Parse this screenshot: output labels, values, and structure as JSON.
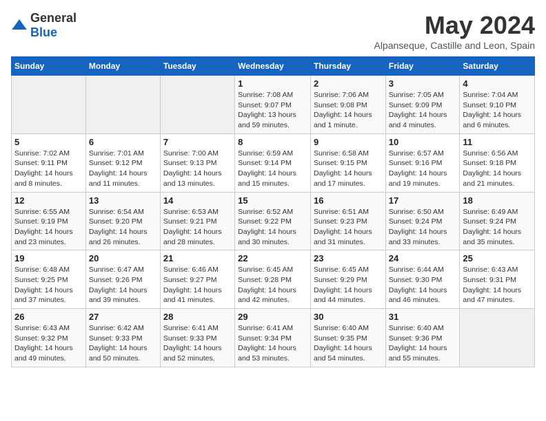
{
  "header": {
    "logo_general": "General",
    "logo_blue": "Blue",
    "month_title": "May 2024",
    "location": "Alpanseque, Castille and Leon, Spain"
  },
  "calendar": {
    "days_of_week": [
      "Sunday",
      "Monday",
      "Tuesday",
      "Wednesday",
      "Thursday",
      "Friday",
      "Saturday"
    ],
    "weeks": [
      [
        {
          "day": "",
          "info": ""
        },
        {
          "day": "",
          "info": ""
        },
        {
          "day": "",
          "info": ""
        },
        {
          "day": "1",
          "info": "Sunrise: 7:08 AM\nSunset: 9:07 PM\nDaylight: 13 hours and 59 minutes."
        },
        {
          "day": "2",
          "info": "Sunrise: 7:06 AM\nSunset: 9:08 PM\nDaylight: 14 hours and 1 minute."
        },
        {
          "day": "3",
          "info": "Sunrise: 7:05 AM\nSunset: 9:09 PM\nDaylight: 14 hours and 4 minutes."
        },
        {
          "day": "4",
          "info": "Sunrise: 7:04 AM\nSunset: 9:10 PM\nDaylight: 14 hours and 6 minutes."
        }
      ],
      [
        {
          "day": "5",
          "info": "Sunrise: 7:02 AM\nSunset: 9:11 PM\nDaylight: 14 hours and 8 minutes."
        },
        {
          "day": "6",
          "info": "Sunrise: 7:01 AM\nSunset: 9:12 PM\nDaylight: 14 hours and 11 minutes."
        },
        {
          "day": "7",
          "info": "Sunrise: 7:00 AM\nSunset: 9:13 PM\nDaylight: 14 hours and 13 minutes."
        },
        {
          "day": "8",
          "info": "Sunrise: 6:59 AM\nSunset: 9:14 PM\nDaylight: 14 hours and 15 minutes."
        },
        {
          "day": "9",
          "info": "Sunrise: 6:58 AM\nSunset: 9:15 PM\nDaylight: 14 hours and 17 minutes."
        },
        {
          "day": "10",
          "info": "Sunrise: 6:57 AM\nSunset: 9:16 PM\nDaylight: 14 hours and 19 minutes."
        },
        {
          "day": "11",
          "info": "Sunrise: 6:56 AM\nSunset: 9:18 PM\nDaylight: 14 hours and 21 minutes."
        }
      ],
      [
        {
          "day": "12",
          "info": "Sunrise: 6:55 AM\nSunset: 9:19 PM\nDaylight: 14 hours and 23 minutes."
        },
        {
          "day": "13",
          "info": "Sunrise: 6:54 AM\nSunset: 9:20 PM\nDaylight: 14 hours and 26 minutes."
        },
        {
          "day": "14",
          "info": "Sunrise: 6:53 AM\nSunset: 9:21 PM\nDaylight: 14 hours and 28 minutes."
        },
        {
          "day": "15",
          "info": "Sunrise: 6:52 AM\nSunset: 9:22 PM\nDaylight: 14 hours and 30 minutes."
        },
        {
          "day": "16",
          "info": "Sunrise: 6:51 AM\nSunset: 9:23 PM\nDaylight: 14 hours and 31 minutes."
        },
        {
          "day": "17",
          "info": "Sunrise: 6:50 AM\nSunset: 9:24 PM\nDaylight: 14 hours and 33 minutes."
        },
        {
          "day": "18",
          "info": "Sunrise: 6:49 AM\nSunset: 9:24 PM\nDaylight: 14 hours and 35 minutes."
        }
      ],
      [
        {
          "day": "19",
          "info": "Sunrise: 6:48 AM\nSunset: 9:25 PM\nDaylight: 14 hours and 37 minutes."
        },
        {
          "day": "20",
          "info": "Sunrise: 6:47 AM\nSunset: 9:26 PM\nDaylight: 14 hours and 39 minutes."
        },
        {
          "day": "21",
          "info": "Sunrise: 6:46 AM\nSunset: 9:27 PM\nDaylight: 14 hours and 41 minutes."
        },
        {
          "day": "22",
          "info": "Sunrise: 6:45 AM\nSunset: 9:28 PM\nDaylight: 14 hours and 42 minutes."
        },
        {
          "day": "23",
          "info": "Sunrise: 6:45 AM\nSunset: 9:29 PM\nDaylight: 14 hours and 44 minutes."
        },
        {
          "day": "24",
          "info": "Sunrise: 6:44 AM\nSunset: 9:30 PM\nDaylight: 14 hours and 46 minutes."
        },
        {
          "day": "25",
          "info": "Sunrise: 6:43 AM\nSunset: 9:31 PM\nDaylight: 14 hours and 47 minutes."
        }
      ],
      [
        {
          "day": "26",
          "info": "Sunrise: 6:43 AM\nSunset: 9:32 PM\nDaylight: 14 hours and 49 minutes."
        },
        {
          "day": "27",
          "info": "Sunrise: 6:42 AM\nSunset: 9:33 PM\nDaylight: 14 hours and 50 minutes."
        },
        {
          "day": "28",
          "info": "Sunrise: 6:41 AM\nSunset: 9:33 PM\nDaylight: 14 hours and 52 minutes."
        },
        {
          "day": "29",
          "info": "Sunrise: 6:41 AM\nSunset: 9:34 PM\nDaylight: 14 hours and 53 minutes."
        },
        {
          "day": "30",
          "info": "Sunrise: 6:40 AM\nSunset: 9:35 PM\nDaylight: 14 hours and 54 minutes."
        },
        {
          "day": "31",
          "info": "Sunrise: 6:40 AM\nSunset: 9:36 PM\nDaylight: 14 hours and 55 minutes."
        },
        {
          "day": "",
          "info": ""
        }
      ]
    ]
  }
}
